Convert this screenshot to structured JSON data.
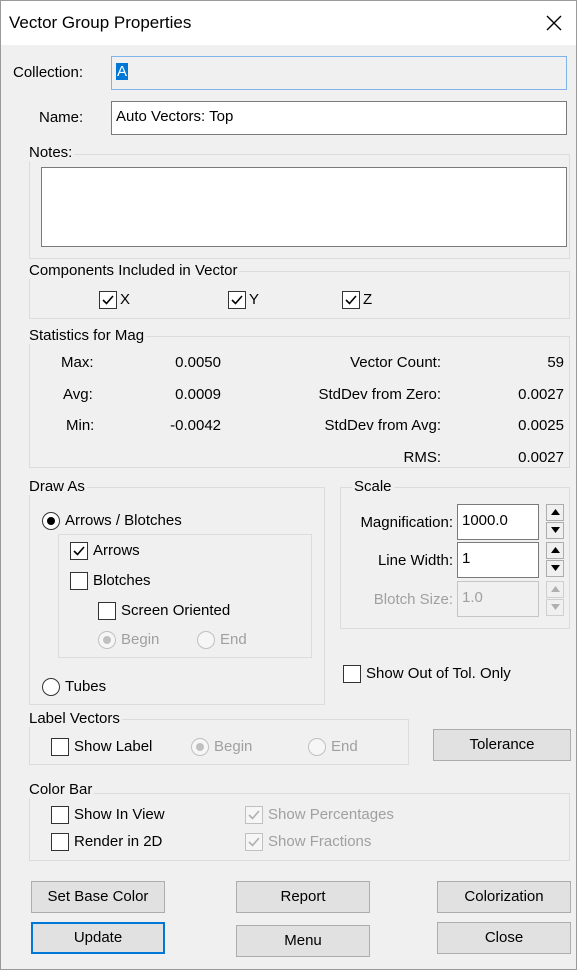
{
  "title": "Vector Group Properties",
  "collection": {
    "label": "Collection:",
    "value": "A"
  },
  "name": {
    "label": "Name:",
    "value": "Auto Vectors: Top"
  },
  "notes": {
    "label": "Notes:",
    "value": ""
  },
  "components": {
    "label": "Components Included in Vector",
    "x": {
      "label": "X",
      "checked": true
    },
    "y": {
      "label": "Y",
      "checked": true
    },
    "z": {
      "label": "Z",
      "checked": true
    }
  },
  "statistics": {
    "label": "Statistics for Mag",
    "max_label": "Max:",
    "max": "0.0050",
    "avg_label": "Avg:",
    "avg": "0.0009",
    "min_label": "Min:",
    "min": "-0.0042",
    "count_label": "Vector Count:",
    "count": "59",
    "stddev_zero_label": "StdDev from Zero:",
    "stddev_zero": "0.0027",
    "stddev_avg_label": "StdDev from  Avg:",
    "stddev_avg": "0.0025",
    "rms_label": "RMS:",
    "rms": "0.0027"
  },
  "draw_as": {
    "label": "Draw As",
    "arrows_blotches": "Arrows / Blotches",
    "arrows": "Arrows",
    "blotches": "Blotches",
    "screen_oriented": "Screen Oriented",
    "begin": "Begin",
    "end": "End",
    "tubes": "Tubes"
  },
  "scale": {
    "label": "Scale",
    "magnification_label": "Magnification:",
    "magnification": "1000.0",
    "line_width_label": "Line Width:",
    "line_width": "1",
    "blotch_size_label": "Blotch Size:",
    "blotch_size": "1.0"
  },
  "show_out_of_tol": "Show Out of Tol. Only",
  "label_vectors": {
    "label": "Label Vectors",
    "show_label": "Show Label",
    "begin": "Begin",
    "end": "End"
  },
  "tolerance_button": "Tolerance",
  "color_bar": {
    "label": "Color Bar",
    "show_in_view": "Show In View",
    "render_2d": "Render in 2D",
    "show_percentages": "Show Percentages",
    "show_fractions": "Show Fractions"
  },
  "buttons": {
    "set_base_color": "Set Base Color",
    "report": "Report",
    "colorization": "Colorization",
    "update": "Update",
    "menu": "Menu",
    "close": "Close"
  },
  "colors": {
    "accent": "#0078d7",
    "selection": "#0078d7",
    "face": "#f0f0f0"
  },
  "icons": {
    "close": "close-icon",
    "check": "checkmark-icon",
    "spin_up": "spin-up-icon",
    "spin_down": "spin-down-icon"
  }
}
